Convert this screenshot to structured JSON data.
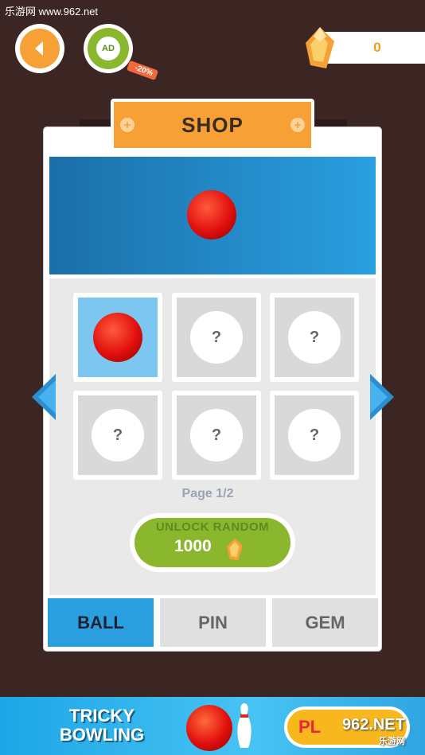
{
  "watermark": {
    "text": "乐游网 www.962.net"
  },
  "top_bar": {
    "back_icon": "chevron-left-icon",
    "ad_label": "AD",
    "ad_discount": "-20%",
    "gem_count": "0"
  },
  "shop": {
    "title": "SHOP",
    "preview_item": "red-ball",
    "items": [
      {
        "type": "ball",
        "locked": false,
        "selected": true,
        "label": ""
      },
      {
        "type": "locked",
        "locked": true,
        "label": "?"
      },
      {
        "type": "locked",
        "locked": true,
        "label": "?"
      },
      {
        "type": "locked",
        "locked": true,
        "label": "?"
      },
      {
        "type": "locked",
        "locked": true,
        "label": "?"
      },
      {
        "type": "locked",
        "locked": true,
        "label": "?"
      }
    ],
    "page_label": "Page 1/2",
    "unlock": {
      "label": "UNLOCK RANDOM",
      "price": "1000"
    },
    "tabs": [
      {
        "label": "BALL",
        "active": true
      },
      {
        "label": "PIN",
        "active": false
      },
      {
        "label": "GEM",
        "active": false
      }
    ]
  },
  "ad_banner": {
    "title_line1": "TRICKY",
    "title_line2": "BOWLING",
    "play_label": "PL",
    "watermark": "962.NET",
    "watermark_sub": "乐游网"
  },
  "colors": {
    "background": "#3c2624",
    "accent_orange": "#f6a036",
    "accent_green": "#8bb72f",
    "accent_blue": "#2a9fe0"
  }
}
